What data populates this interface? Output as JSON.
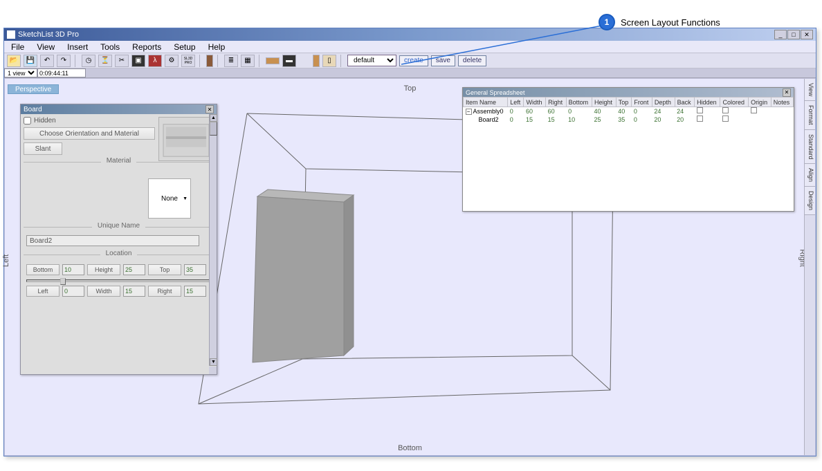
{
  "annotation": {
    "num": "1",
    "text": "Screen Layout Functions"
  },
  "titlebar": {
    "title": "SketchList 3D Pro"
  },
  "menubar": [
    "File",
    "View",
    "Insert",
    "Tools",
    "Reports",
    "Setup",
    "Help"
  ],
  "toolbar": {
    "select_value": "default",
    "btn_create": "create",
    "btn_save": "save",
    "btn_delete": "delete"
  },
  "statusbar": {
    "view_select": "1 view",
    "timecode": "0:09:44:11"
  },
  "tabs": {
    "perspective": "Perspective"
  },
  "viewport": {
    "top": "Top",
    "bottom": "Bottom",
    "left": "Left",
    "right": "Right"
  },
  "board_panel": {
    "title": "Board",
    "hidden_label": "Hidden",
    "btn_orientation": "Choose Orientation and Material",
    "btn_slant": "Slant",
    "section_material": "Material",
    "material_value": "None",
    "section_unique": "Unique Name",
    "unique_value": "Board2",
    "section_location": "Location",
    "loc": [
      {
        "label": "Bottom",
        "val": "10"
      },
      {
        "label": "Height",
        "val": "25"
      },
      {
        "label": "Top",
        "val": "35"
      },
      {
        "label": "Left",
        "val": "0"
      },
      {
        "label": "Width",
        "val": "15"
      },
      {
        "label": "Right",
        "val": "15"
      }
    ]
  },
  "spreadsheet": {
    "title": "General Spreadsheet",
    "columns": [
      "Item Name",
      "Left",
      "Width",
      "Right",
      "Bottom",
      "Height",
      "Top",
      "Front",
      "Depth",
      "Back",
      "Hidden",
      "Colored",
      "Origin",
      "Notes"
    ],
    "rows": [
      {
        "name": "Assembly0",
        "data": [
          "0",
          "60",
          "60",
          "0",
          "40",
          "40",
          "0",
          "24",
          "24"
        ],
        "expandable": true
      },
      {
        "name": "Board2",
        "data": [
          "0",
          "15",
          "15",
          "10",
          "25",
          "35",
          "0",
          "20",
          "20"
        ],
        "expandable": false,
        "indent": true
      }
    ]
  },
  "side_tabs": [
    "View",
    "Format",
    "Standard",
    "Align",
    "Design"
  ],
  "chart_data": {
    "type": "table",
    "title": "General Spreadsheet",
    "columns": [
      "Item Name",
      "Left",
      "Width",
      "Right",
      "Bottom",
      "Height",
      "Top",
      "Front",
      "Depth",
      "Back"
    ],
    "rows": [
      [
        "Assembly0",
        0,
        60,
        60,
        0,
        40,
        40,
        0,
        24,
        24
      ],
      [
        "Board2",
        0,
        15,
        15,
        10,
        25,
        35,
        0,
        20,
        20
      ]
    ]
  }
}
